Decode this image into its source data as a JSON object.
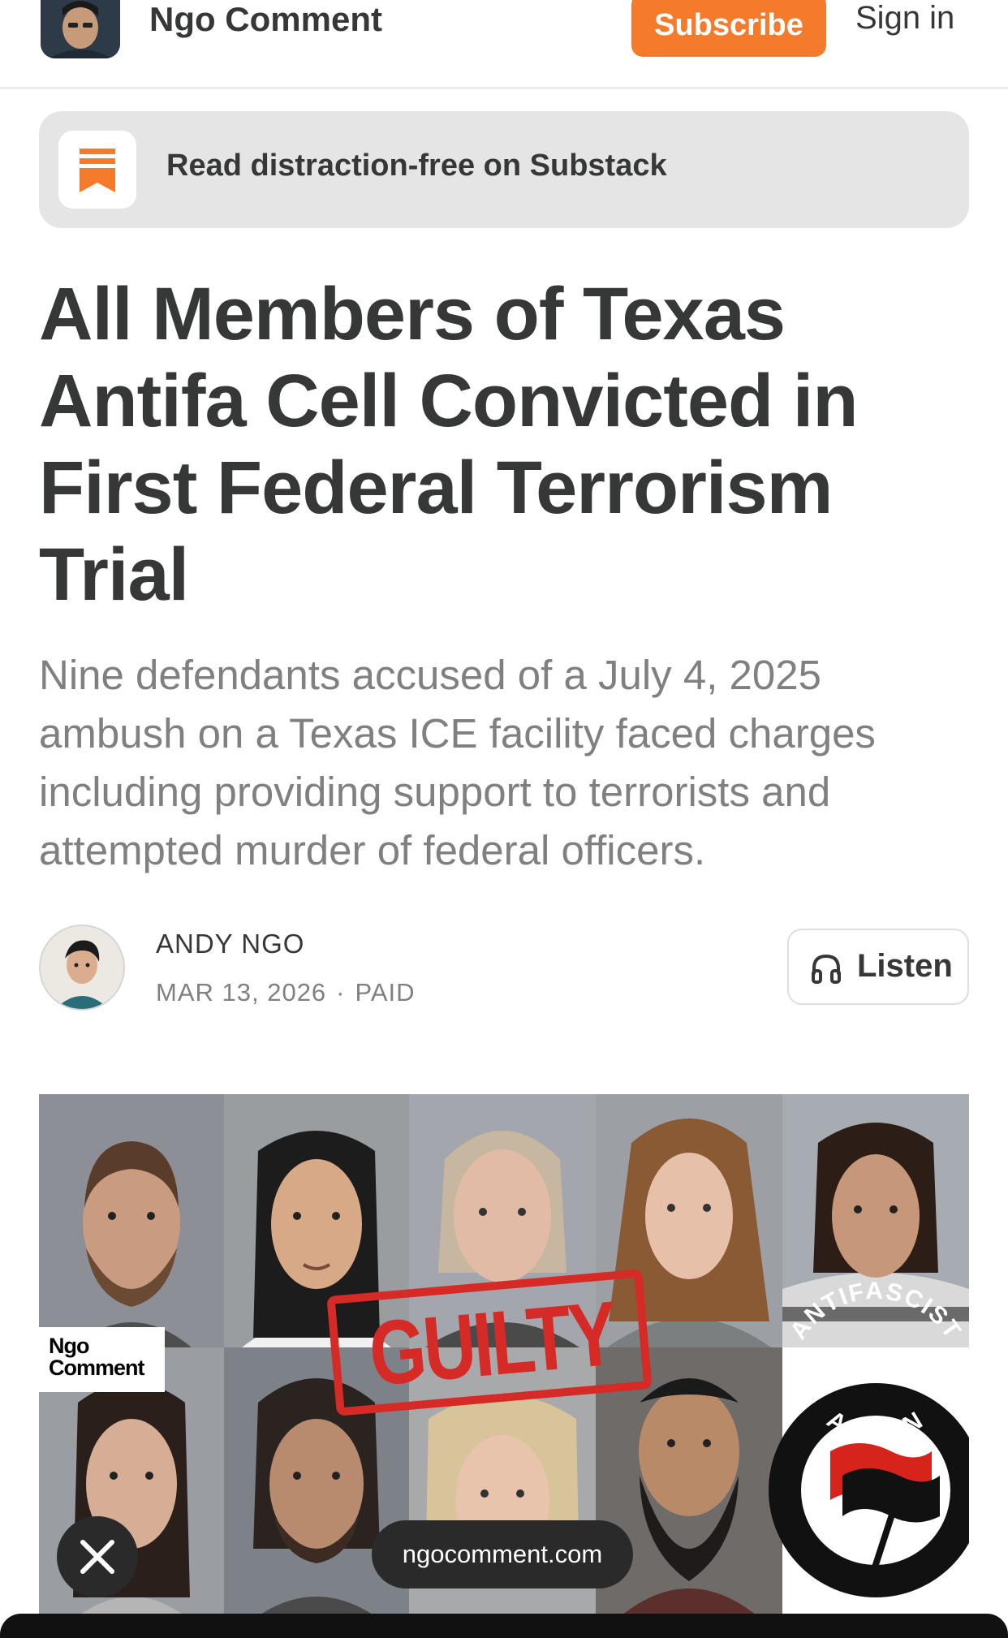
{
  "header": {
    "publication_name": "Ngo Comment",
    "subscribe_label": "Subscribe",
    "signin_label": "Sign in"
  },
  "banner": {
    "text": "Read distraction-free on Substack"
  },
  "article": {
    "title": "All Members of Texas Antifa Cell Convicted in First Federal Terrorism Trial",
    "subtitle": "Nine defendants accused of a July 4, 2025 ambush on a Texas ICE facility faced charges including providing support to terrorists and attempted murder of federal officers.",
    "author": "ANDY NGO",
    "date": "MAR 13, 2026",
    "separator": "·",
    "access": "PAID",
    "listen_label": "Listen"
  },
  "hero": {
    "watermark_line1": "Ngo",
    "watermark_line2": "Comment",
    "stamp_text": "GUILTY",
    "emblem_top": "ANTIFASCIST",
    "emblem_bottom": "ACTION",
    "url_label": "ngocomment.com"
  },
  "colors": {
    "accent": "#f47b2c",
    "text": "#363737",
    "muted": "#808080",
    "banner_bg": "#e5e5e5",
    "stamp_red": "#d62a26"
  }
}
